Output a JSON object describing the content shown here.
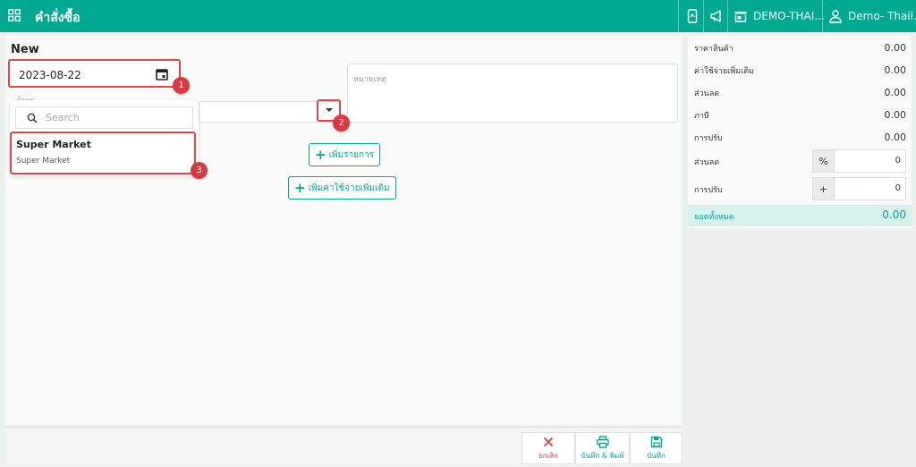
{
  "header": {
    "title": "คำสั่งซื้อ",
    "branch": "DEMO-THAI...",
    "user": "Demo- Thail..."
  },
  "form": {
    "heading": "New",
    "date_value": "2023-08-22",
    "supplier_label": "ผู้ขาย",
    "note_placeholder": "หมายเหตุ",
    "search_placeholder": "Search",
    "options": [
      {
        "name": "Super Market",
        "sub": "Super Market"
      }
    ],
    "add_item_label": "เพิ่มรายการ",
    "add_expense_label": "เพิ่มค่าใช้จ่ายเพิ่มเติม"
  },
  "badges": [
    "1",
    "2",
    "3"
  ],
  "summary": {
    "rows": [
      {
        "label": "ราคาสินค้า",
        "value": "0.00"
      },
      {
        "label": "ค่าใช้จ่ายเพิ่มเติม",
        "value": "0.00"
      },
      {
        "label": "ส่วนลด",
        "value": "0.00"
      },
      {
        "label": "ภาษี",
        "value": "0.00"
      },
      {
        "label": "การปรับ",
        "value": "0.00"
      }
    ],
    "discount": {
      "label": "ส่วนลด",
      "symbol": "%",
      "value": "0"
    },
    "adjust": {
      "label": "การปรับ",
      "symbol": "+",
      "value": "0"
    },
    "total": {
      "label": "ยอดทั้งหมด",
      "value": "0.00"
    }
  },
  "footer": {
    "cancel_label": "ยกเลิก",
    "save_print_label": "บันทึก & พิมพ์",
    "save_label": "บันทึก"
  },
  "colors": {
    "brand": "#00a98f",
    "highlight": "#e0474c",
    "badge": "#d83a3f",
    "danger": "#e03b3b"
  }
}
